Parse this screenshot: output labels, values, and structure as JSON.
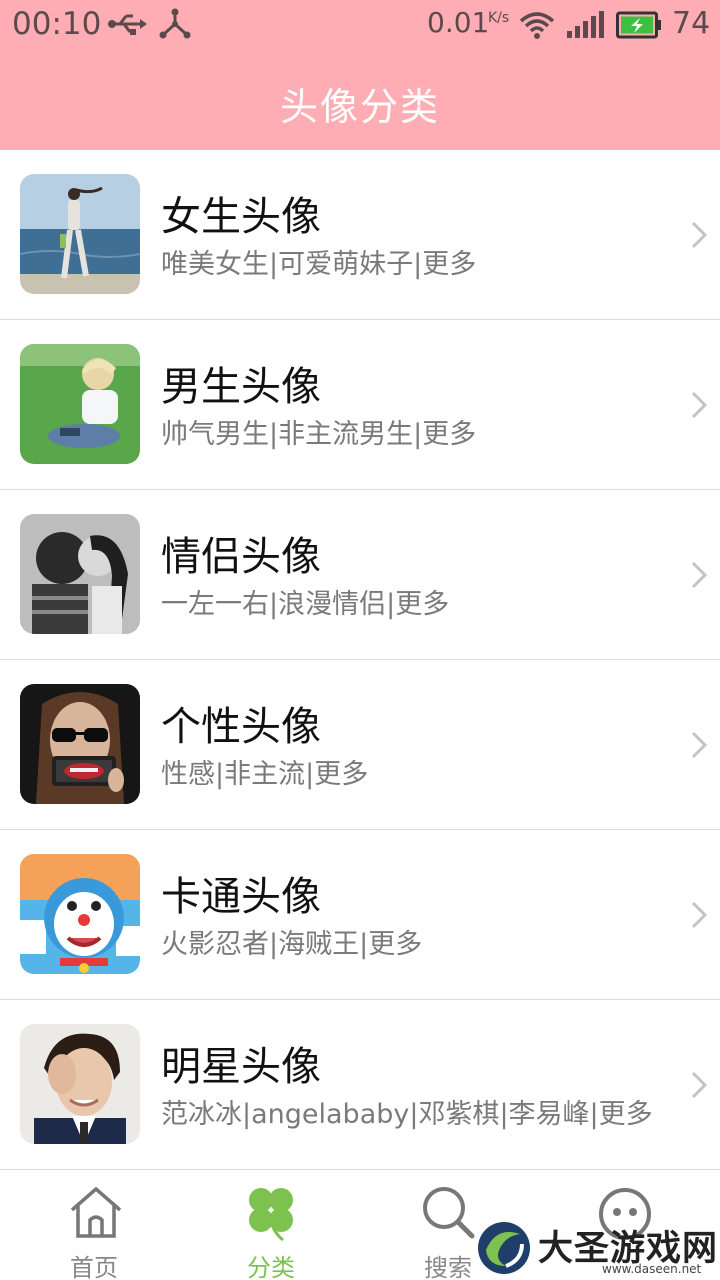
{
  "status_bar": {
    "time": "00:10",
    "speed": "0.01",
    "speed_unit": "K/s",
    "battery_percent": "74"
  },
  "header": {
    "title": "头像分类"
  },
  "categories": [
    {
      "title": "女生头像",
      "subtitle": "唯美女生|可爱萌妹子|更多"
    },
    {
      "title": "男生头像",
      "subtitle": "帅气男生|非主流男生|更多"
    },
    {
      "title": "情侣头像",
      "subtitle": "一左一右|浪漫情侣|更多"
    },
    {
      "title": "个性头像",
      "subtitle": "性感|非主流|更多"
    },
    {
      "title": "卡通头像",
      "subtitle": "火影忍者|海贼王|更多"
    },
    {
      "title": "明星头像",
      "subtitle": "范冰冰|angelababy|邓紫棋|李易峰|更多"
    }
  ],
  "nav": {
    "home_label": "首页",
    "category_label": "分类",
    "search_label": "搜索"
  },
  "watermark": {
    "text": "大圣游戏网",
    "url": "www.daseen.net"
  },
  "colors": {
    "header_bg": "#FFADB5",
    "active_tab": "#7DC24F"
  }
}
